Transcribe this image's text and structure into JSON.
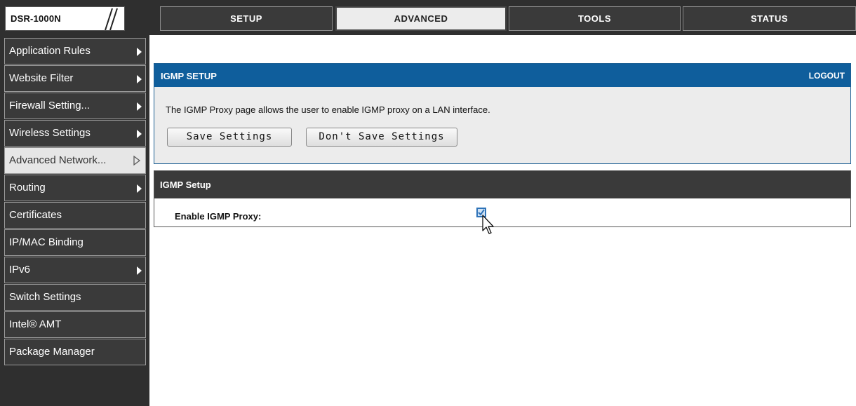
{
  "header": {
    "model": "DSR-1000N",
    "tabs": [
      {
        "label": "SETUP"
      },
      {
        "label": "ADVANCED"
      },
      {
        "label": "TOOLS"
      },
      {
        "label": "STATUS"
      }
    ]
  },
  "sidebar": {
    "items": [
      {
        "label": "Application Rules"
      },
      {
        "label": "Website Filter"
      },
      {
        "label": "Firewall Setting..."
      },
      {
        "label": "Wireless Settings"
      },
      {
        "label": "Advanced Network..."
      },
      {
        "label": "Routing"
      },
      {
        "label": "Certificates"
      },
      {
        "label": "IP/MAC Binding"
      },
      {
        "label": "IPv6"
      },
      {
        "label": "Switch Settings"
      },
      {
        "label": "Intel® AMT"
      },
      {
        "label": "Package Manager"
      }
    ]
  },
  "panel": {
    "title": "IGMP SETUP",
    "logout": "LOGOUT",
    "description": "The IGMP Proxy page allows the user to enable IGMP proxy on a LAN interface.",
    "save_label": "Save Settings",
    "dont_save_label": "Don't Save Settings"
  },
  "section": {
    "title": "IGMP Setup",
    "field_label": "Enable IGMP Proxy:",
    "enabled": true
  },
  "colors": {
    "panel_header": "#0f5e9c",
    "dark_bg": "#2f2f2f"
  }
}
